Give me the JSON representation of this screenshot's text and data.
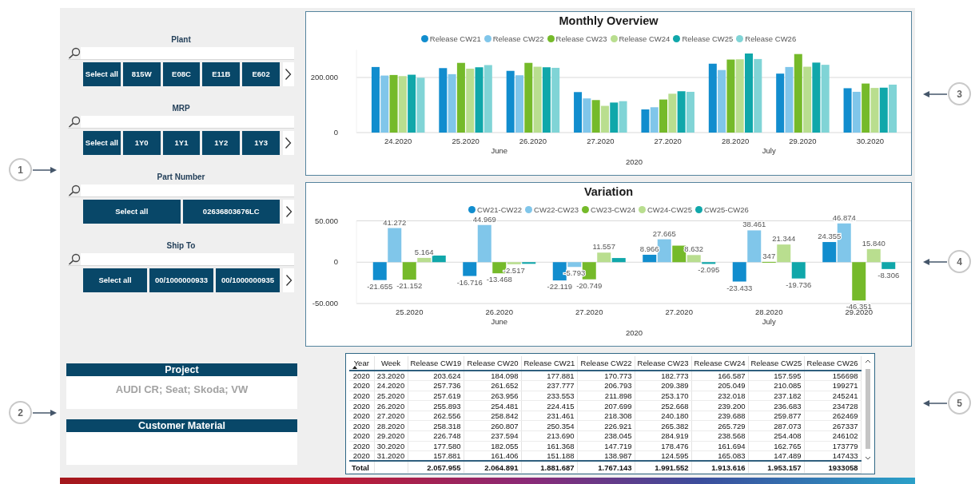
{
  "slicers": [
    {
      "title": "Plant",
      "options": [
        "Select all",
        "815W",
        "E08C",
        "E11B",
        "E602"
      ]
    },
    {
      "title": "MRP",
      "options": [
        "Select all",
        "1Y0",
        "1Y1",
        "1Y2",
        "1Y3"
      ]
    },
    {
      "title": "Part Number",
      "options": [
        "Select all",
        "02636803676LC"
      ]
    },
    {
      "title": "Ship To",
      "options": [
        "Select all",
        "00/1000000933",
        "00/1000000935"
      ]
    }
  ],
  "cards": [
    {
      "title": "Project",
      "value": "AUDI CR; Seat; Skoda; VW"
    },
    {
      "title": "Customer Material"
    }
  ],
  "monthly_overview": {
    "chart_data": {
      "type": "bar",
      "title": "Monthly Overview",
      "xlabel": "2020",
      "categories": [
        "24.2020",
        "25.2020",
        "26.2020",
        "27.2020",
        "27.2020",
        "28.2020",
        "29.2020",
        "30.2020"
      ],
      "annotations": [
        "June",
        "July"
      ],
      "ylim": [
        0,
        300000
      ],
      "yticks": [
        {
          "value": 0,
          "label": "0"
        },
        {
          "value": 200000,
          "label": "200.000"
        }
      ],
      "series": [
        {
          "name": "Release CW21",
          "color": "#118dce",
          "values": [
            238000,
            234000,
            224000,
            147000,
            84000,
            250000,
            214000,
            161000
          ]
        },
        {
          "name": "Release CW22",
          "color": "#80c6ea",
          "values": [
            207000,
            212000,
            208000,
            124000,
            92000,
            227000,
            238000,
            148000
          ]
        },
        {
          "name": "Release CW23",
          "color": "#75ba2a",
          "values": [
            209000,
            253000,
            253000,
            118000,
            120000,
            265000,
            285000,
            178000
          ]
        },
        {
          "name": "Release CW24",
          "color": "#b9de8f",
          "values": [
            205000,
            232000,
            239000,
            97000,
            141000,
            266000,
            239000,
            162000
          ]
        },
        {
          "name": "Release CW25",
          "color": "#10a7aa",
          "values": [
            210000,
            237000,
            237000,
            109000,
            150000,
            287000,
            254000,
            163000
          ]
        },
        {
          "name": "Release CW26",
          "color": "#80d4d6",
          "values": [
            199000,
            245000,
            235000,
            114000,
            148000,
            267000,
            246000,
            174000
          ]
        }
      ]
    }
  },
  "variation": {
    "chart_data": {
      "type": "bar",
      "title": "Variation",
      "xlabel": "2020",
      "categories": [
        "25.2020",
        "26.2020",
        "27.2020",
        "27.2020",
        "28.2020",
        "29.2020"
      ],
      "annotations": [
        "June",
        "July"
      ],
      "ylim": [
        -50000,
        50000
      ],
      "yticks": [
        {
          "value": -50000,
          "label": "-50.000"
        },
        {
          "value": 0,
          "label": "0"
        },
        {
          "value": 50000,
          "label": "50.000"
        }
      ],
      "series": [
        {
          "name": "CW21-CW22",
          "color": "#118dce",
          "values": [
            -21655,
            -16716,
            -22119,
            8966,
            -23433,
            24355
          ],
          "value_labels": [
            "-21.655",
            "-16.716",
            "-22.119",
            "8.966",
            "-23.433",
            "24.355"
          ]
        },
        {
          "name": "CW22-CW23",
          "color": "#80c6ea",
          "values": [
            41272,
            44969,
            -5793,
            27665,
            38461,
            46874
          ],
          "value_labels": [
            "41.272",
            "44.969",
            "-5.793",
            "27.665",
            "38.461",
            "46.874"
          ]
        },
        {
          "name": "CW23-CW24",
          "color": "#75ba2a",
          "values": [
            -21152,
            -13468,
            -20749,
            20000,
            347,
            -46351
          ],
          "value_labels": [
            "-21.152",
            "-13.468",
            "-20.749",
            null,
            "347",
            "-46.351"
          ]
        },
        {
          "name": "CW24-CW25",
          "color": "#b9de8f",
          "values": [
            5164,
            -2517,
            11557,
            8632,
            21344,
            15840
          ],
          "value_labels": [
            "5.164",
            "-2.517",
            "11.557",
            "8.632",
            "21.344",
            "15.840"
          ]
        },
        {
          "name": "CW25-CW26",
          "color": "#10a7aa",
          "values": [
            8000,
            -2000,
            5000,
            -2095,
            -19736,
            -8306
          ],
          "value_labels": [
            null,
            null,
            null,
            "-2.095",
            "-19.736",
            "-8.306"
          ]
        }
      ]
    }
  },
  "table": {
    "columns": [
      {
        "label": "Year",
        "sorted": true
      },
      {
        "label": "Week",
        "sorted": false
      },
      {
        "label": "Release CW19",
        "sorted": false
      },
      {
        "label": "Release CW20",
        "sorted": false
      },
      {
        "label": "Release CW21",
        "sorted": false
      },
      {
        "label": "Release CW22",
        "sorted": false
      },
      {
        "label": "Release CW23",
        "sorted": false
      },
      {
        "label": "Release CW24",
        "sorted": false
      },
      {
        "label": "Release CW25",
        "sorted": false
      },
      {
        "label": "Release CW26",
        "sorted": false
      }
    ],
    "rows": [
      [
        "2020",
        "23.2020",
        "203.624",
        "184.098",
        "177.881",
        "170.773",
        "182.773",
        "166.587",
        "157.595",
        "156698"
      ],
      [
        "2020",
        "24.2020",
        "257.736",
        "261.652",
        "237.777",
        "206.793",
        "209.389",
        "205.049",
        "210.085",
        "199271"
      ],
      [
        "2020",
        "25.2020",
        "257.619",
        "263.956",
        "233.553",
        "211.898",
        "253.170",
        "232.018",
        "237.182",
        "245241"
      ],
      [
        "2020",
        "26.2020",
        "255.893",
        "254.481",
        "224.415",
        "207.699",
        "252.668",
        "239.200",
        "236.683",
        "234728"
      ],
      [
        "2020",
        "27.2020",
        "262.556",
        "258.842",
        "231.461",
        "218.308",
        "240.180",
        "239.688",
        "259.877",
        "262469"
      ],
      [
        "2020",
        "28.2020",
        "258.318",
        "260.807",
        "250.354",
        "226.921",
        "265.382",
        "265.729",
        "287.073",
        "267337"
      ],
      [
        "2020",
        "29.2020",
        "226.748",
        "237.594",
        "213.690",
        "238.045",
        "284.919",
        "238.568",
        "254.408",
        "246102"
      ],
      [
        "2020",
        "30.2020",
        "177.580",
        "182.055",
        "161.368",
        "147.719",
        "178.476",
        "161.694",
        "162.765",
        "173779"
      ],
      [
        "2020",
        "31.2020",
        "157.881",
        "161.406",
        "151.188",
        "138.987",
        "124.595",
        "165.083",
        "147.489",
        "147433"
      ]
    ],
    "total": {
      "label": "Total",
      "values": [
        "2.057.955",
        "2.064.891",
        "1.881.687",
        "1.767.143",
        "1.991.552",
        "1.913.616",
        "1.953.157",
        "1933058"
      ]
    }
  },
  "callouts": [
    {
      "label": "1"
    },
    {
      "label": "2"
    },
    {
      "label": "3"
    },
    {
      "label": "4"
    },
    {
      "label": "5"
    }
  ]
}
